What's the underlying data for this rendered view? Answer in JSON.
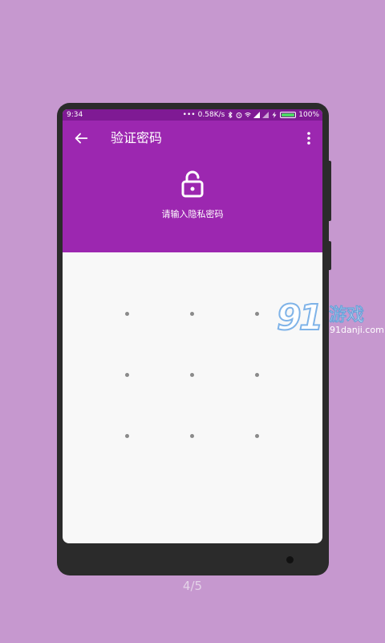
{
  "statusbar": {
    "time": "9:34",
    "net_speed": "0.58K/s",
    "battery": "100%"
  },
  "appbar": {
    "title": "验证密码",
    "back_icon": "arrow-left-icon",
    "more_icon": "more-vertical-icon"
  },
  "header": {
    "prompt": "请输入隐私密码",
    "lock_icon": "unlock-icon"
  },
  "pattern": {
    "rows": 3,
    "cols": 3
  },
  "pager": {
    "text": "4/5"
  },
  "watermark": {
    "logo_number": "91",
    "logo_title": "游戏",
    "url": "91danji.com"
  },
  "colors": {
    "background": "#c698cf",
    "primary": "#9c27b0",
    "primary_dark": "#7f1a94",
    "screen": "#f8f8f8",
    "dot": "#8a8a8a"
  }
}
